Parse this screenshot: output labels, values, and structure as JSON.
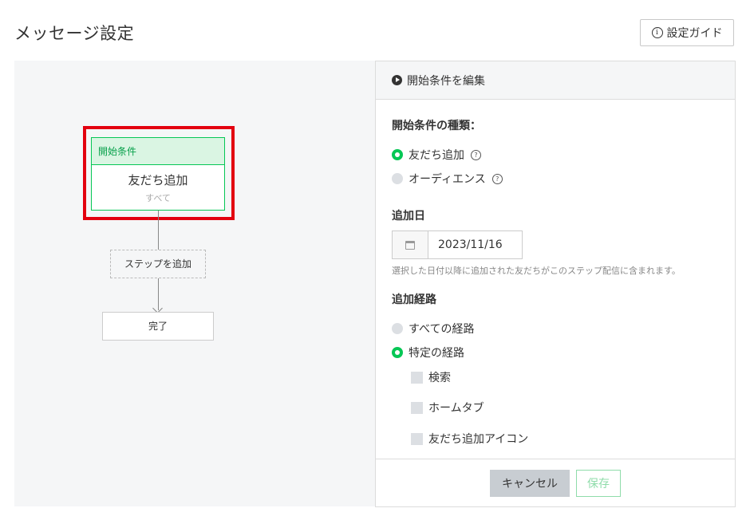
{
  "header": {
    "title": "メッセージ設定",
    "guide_button": {
      "icon": "info-icon",
      "label": "設定ガイド"
    }
  },
  "flow": {
    "start_node": {
      "header": "開始条件",
      "title": "友だち追加",
      "subtitle": "すべて"
    },
    "add_step_label": "ステップを追加",
    "end_node_label": "完了",
    "highlight_color": "#e3000f"
  },
  "panel": {
    "header": {
      "icon": "play-circle-icon",
      "title": "開始条件を編集"
    },
    "trigger_type": {
      "label": "開始条件の種類：",
      "options": [
        {
          "label": "友だち追加",
          "selected": true
        },
        {
          "label": "オーディエンス",
          "selected": false
        }
      ]
    },
    "added_date": {
      "label": "追加日",
      "value": "2023/11/16",
      "help": "選択した日付以降に追加された友だちがこのステップ配信に含まれます。"
    },
    "source": {
      "label": "追加経路",
      "options": [
        {
          "label": "すべての経路",
          "selected": false
        },
        {
          "label": "特定の経路",
          "selected": true
        }
      ],
      "checkboxes": [
        {
          "label": "検索",
          "checked": false
        },
        {
          "label": "ホームタブ",
          "checked": false
        },
        {
          "label": "友だち追加アイコン",
          "checked": false
        }
      ]
    },
    "footer": {
      "cancel_label": "キャンセル",
      "save_label": "保存"
    }
  },
  "colors": {
    "accent": "#06c755",
    "canvas_bg": "#f5f6f7"
  }
}
